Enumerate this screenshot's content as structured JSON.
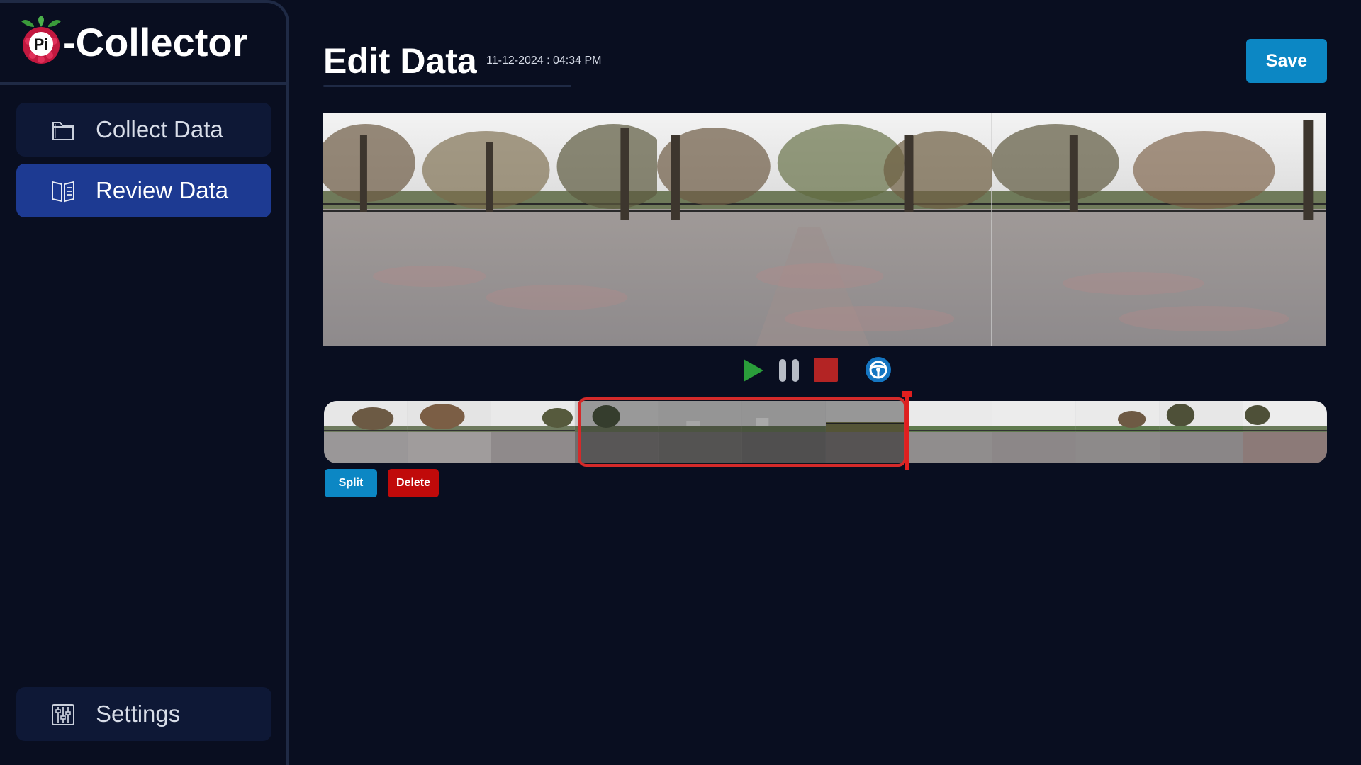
{
  "brand": {
    "logo_text": "Pi",
    "name": "-Collector"
  },
  "sidebar": {
    "items": [
      {
        "label": "Collect Data",
        "icon": "folder-icon",
        "active": false
      },
      {
        "label": "Review Data",
        "icon": "book-icon",
        "active": true
      }
    ],
    "footer": {
      "label": "Settings",
      "icon": "sliders-icon"
    }
  },
  "header": {
    "title": "Edit Data",
    "datetime": "11-12-2024 : 04:34 PM",
    "save_label": "Save"
  },
  "playback": {
    "controls": [
      "play-icon",
      "pause-icon",
      "stop-icon",
      "steering-wheel-icon"
    ]
  },
  "timeline": {
    "thumbnail_count": 12,
    "selected_range": [
      3,
      6
    ]
  },
  "actions": {
    "split_label": "Split",
    "delete_label": "Delete"
  },
  "colors": {
    "background": "#090e20",
    "sidebar_active": "#1d3a92",
    "accent_blue": "#0c87c4",
    "danger_red": "#c00a0a",
    "play_green": "#2a9d3a",
    "stop_red": "#b32424"
  }
}
